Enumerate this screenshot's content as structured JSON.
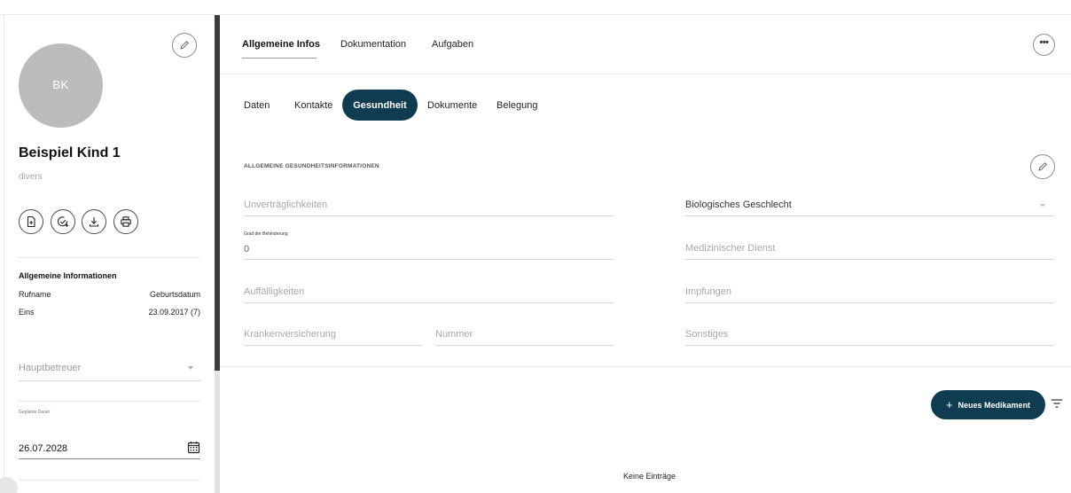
{
  "profile": {
    "initials": "BK",
    "name": "Beispiel Kind 1",
    "gender": "divers"
  },
  "info": {
    "heading": "Allgemeine Informationen",
    "rufname_label": "Rufname",
    "rufname_value": "Eins",
    "birth_label": "Geburtsdatum",
    "birth_value": "23.09.2017 (7)"
  },
  "sidebar_fields": {
    "hauptbetreuer_placeholder": "Hauptbetreuer",
    "geplante_dauer_label": "Geplante Dauer",
    "geplante_dauer_value": "26.07.2028"
  },
  "main_tabs": [
    {
      "label": "Allgemeine Infos",
      "active": true
    },
    {
      "label": "Dokumentation",
      "active": false
    },
    {
      "label": "Aufgaben",
      "active": false
    }
  ],
  "sub_tabs": [
    {
      "label": "Daten"
    },
    {
      "label": "Kontakte"
    },
    {
      "label": "Gesundheit",
      "active": true
    },
    {
      "label": "Dokumente"
    },
    {
      "label": "Belegung"
    }
  ],
  "health": {
    "section_title": "ALLGEMEINE GESUNDHEITSINFORMATIONEN",
    "unvertraeglichkeiten": "Unverträglichkeiten",
    "grad_label": "Grad der Behinderung",
    "grad_value": "0",
    "auffaelligkeiten": "Auffälligkeiten",
    "krankenversicherung": "Krankenversicherung",
    "nummer": "Nummer",
    "biologisches_geschlecht": "Biologisches Geschlecht",
    "medizinischer_dienst": "Medizinischer Dienst",
    "impfungen": "Impfungen",
    "sonstiges": "Sonstiges"
  },
  "medication": {
    "new_button": "Neues Medikament",
    "empty_text": "Keine Einträge"
  },
  "colors": {
    "accent": "#0f3c50",
    "avatar": "#bcbcbc"
  }
}
